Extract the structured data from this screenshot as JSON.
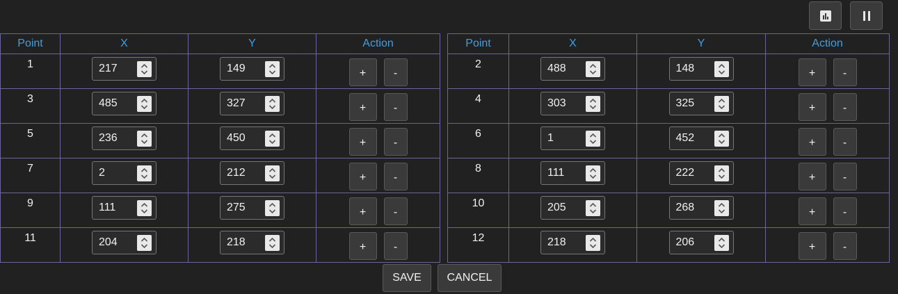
{
  "toolbar": {
    "chart_icon": "bar-chart-icon",
    "pause_icon": "pause-icon"
  },
  "headers": {
    "point": "Point",
    "x": "X",
    "y": "Y",
    "action": "Action"
  },
  "left_rows": [
    {
      "point": "1",
      "x": "217",
      "y": "149"
    },
    {
      "point": "3",
      "x": "485",
      "y": "327"
    },
    {
      "point": "5",
      "x": "236",
      "y": "450"
    },
    {
      "point": "7",
      "x": "2",
      "y": "212"
    },
    {
      "point": "9",
      "x": "111",
      "y": "275"
    },
    {
      "point": "11",
      "x": "204",
      "y": "218"
    }
  ],
  "right_rows": [
    {
      "point": "2",
      "x": "488",
      "y": "148"
    },
    {
      "point": "4",
      "x": "303",
      "y": "325"
    },
    {
      "point": "6",
      "x": "1",
      "y": "452"
    },
    {
      "point": "8",
      "x": "111",
      "y": "222"
    },
    {
      "point": "10",
      "x": "205",
      "y": "268"
    },
    {
      "point": "12",
      "x": "218",
      "y": "206"
    }
  ],
  "action": {
    "add_label": "+",
    "remove_label": "-"
  },
  "footer": {
    "save_label": "SAVE",
    "cancel_label": "CANCEL"
  },
  "colors": {
    "background": "#212121",
    "header_text": "#3aa0e8",
    "grid": "#6b6794",
    "button": "#3a3a3a"
  }
}
